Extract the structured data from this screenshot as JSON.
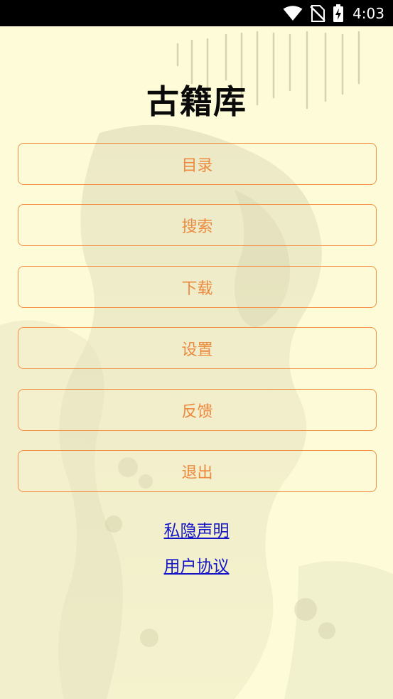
{
  "status_bar": {
    "time": "4:03",
    "icons": [
      "wifi-icon",
      "no-sim-icon",
      "battery-charging-icon"
    ]
  },
  "app": {
    "title": "古籍库"
  },
  "menu": {
    "catalog_label": "目录",
    "search_label": "搜索",
    "download_label": "下载",
    "settings_label": "设置",
    "feedback_label": "反馈",
    "exit_label": "退出"
  },
  "links": {
    "privacy_label": "私隐声明",
    "user_agreement_label": "用户协议"
  },
  "colors": {
    "background": "#fdfbd8",
    "button_border": "#f29044",
    "button_text": "#ec8a3f",
    "link": "#1515c8",
    "title": "#0a0a0a"
  }
}
